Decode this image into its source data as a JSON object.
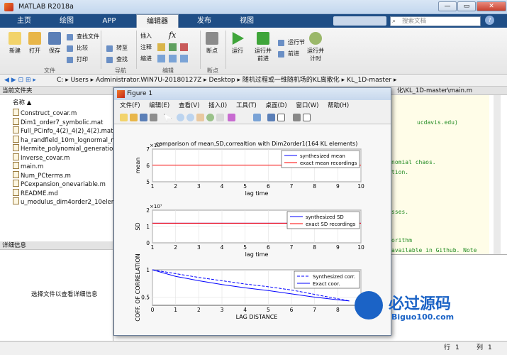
{
  "window": {
    "title": "MATLAB R2018a",
    "min": "—",
    "max": "▭",
    "close": "✕"
  },
  "tabs": [
    "主页",
    "绘图",
    "APP",
    "编辑器",
    "发布",
    "视图"
  ],
  "active_tab": "编辑器",
  "search_placeholder": "搜索文档",
  "ribbon": {
    "new": "新建",
    "open": "打开",
    "save": "保存",
    "find_files": "查找文件",
    "compare": "比较",
    "print": "打印",
    "insert": "插入",
    "comment": "注释",
    "indent": "缩进",
    "goto": "转至",
    "find": "查找",
    "fx": "fx",
    "breakpoint": "断点",
    "run": "运行",
    "run_advance": "运行并\n前进",
    "run_section": "运行节",
    "advance": "前进",
    "run_time": "运行并\n计时",
    "groups": [
      "文件",
      "导航",
      "编辑",
      "断点"
    ]
  },
  "address": [
    "C:",
    "Users",
    "Administrator.WIN7U-20180127Z",
    "Desktop",
    "随机过程或一维随机场的KL离散化",
    "KL_1D-master"
  ],
  "current_folder": {
    "header": "当前文件夹",
    "col_name": "名称 ▲",
    "files": [
      "Construct_covar.m",
      "Dim1_order7_symbolic.mat",
      "Full_PCinfo_4(2)_4(2)_4(2).mat",
      "ha_randfield_10m_lognormal_me",
      "Hermite_polynomial_generation.",
      "Inverse_covar.m",
      "main.m",
      "Num_PCterms.m",
      "PCexpansion_onevariable.m",
      "README.md",
      "u_modulus_dim4order2_10eleme"
    ]
  },
  "details": {
    "header": "详细信息",
    "hint": "选择文件以查看详细信息"
  },
  "editor": {
    "path": "化\\KL_1D-master\\main.m",
    "lines": [
      "ucdavis.edu)",
      "nomial chaos.",
      "tion.",
      "sses.",
      "orithm",
      "available in Github. Note"
    ]
  },
  "status": {
    "row_label": "行",
    "row_value": "1",
    "col_label": "列",
    "col_value": "1"
  },
  "figure": {
    "title": "Figure 1",
    "menu": [
      "文件(F)",
      "编辑(E)",
      "查看(V)",
      "插入(I)",
      "工具(T)",
      "桌面(D)",
      "窗口(W)",
      "帮助(H)"
    ]
  },
  "chart_data": [
    {
      "type": "line",
      "title": "comparison of mean,SD,correaltion with Dim2order1(164 KL elements)",
      "xlabel": "lag time",
      "ylabel": "mean",
      "xlim": [
        1,
        10
      ],
      "ylim": [
        5,
        7
      ],
      "y_exponent": "×10⁵",
      "xticks": [
        1,
        2,
        3,
        4,
        5,
        6,
        7,
        8,
        9,
        10
      ],
      "yticks": [
        5,
        6,
        7
      ],
      "series": [
        {
          "name": "synthesized mean",
          "color": "#0000ff",
          "x": [
            1,
            10
          ],
          "y": [
            6.02,
            6.02
          ]
        },
        {
          "name": "exact mean recordings",
          "color": "#ff0000",
          "x": [
            1,
            10
          ],
          "y": [
            6.02,
            6.02
          ]
        }
      ]
    },
    {
      "type": "line",
      "xlabel": "lag time",
      "ylabel": "SD",
      "xlim": [
        1,
        10
      ],
      "ylim": [
        0,
        2
      ],
      "y_exponent": "×10⁷",
      "xticks": [
        1,
        2,
        3,
        4,
        5,
        6,
        7,
        8,
        9,
        10
      ],
      "yticks": [
        0,
        1,
        2
      ],
      "series": [
        {
          "name": "synthesized SD",
          "color": "#0000ff",
          "x": [
            1,
            10
          ],
          "y": [
            1.2,
            1.2
          ]
        },
        {
          "name": "exact SD recordings",
          "color": "#ff0000",
          "x": [
            1,
            10
          ],
          "y": [
            1.2,
            1.2
          ]
        }
      ]
    },
    {
      "type": "line",
      "xlabel": "LAG DISTANCE",
      "ylabel": "COFF. OF CORRELATION",
      "xlim": [
        0,
        9
      ],
      "ylim": [
        0.35,
        1
      ],
      "xticks": [
        0,
        1,
        2,
        3,
        4,
        5,
        6,
        7,
        8,
        9
      ],
      "yticks": [
        0.5,
        1
      ],
      "series": [
        {
          "name": "Synthesized corr.",
          "color": "#0000ff",
          "dashed": true,
          "x": [
            0,
            1,
            2,
            3,
            4,
            5,
            6,
            7,
            8,
            8.5
          ],
          "y": [
            1,
            0.93,
            0.86,
            0.8,
            0.74,
            0.69,
            0.63,
            0.55,
            0.47,
            0.43
          ]
        },
        {
          "name": "Exact coor.",
          "color": "#0000ff",
          "dashed": false,
          "x": [
            0,
            1,
            2,
            3,
            4,
            5,
            6,
            7,
            8,
            8.5
          ],
          "y": [
            1,
            0.88,
            0.8,
            0.73,
            0.67,
            0.62,
            0.56,
            0.5,
            0.45,
            0.43
          ]
        }
      ]
    }
  ],
  "watermark": {
    "cn": "必过源码",
    "en": "Biguo100.com"
  }
}
